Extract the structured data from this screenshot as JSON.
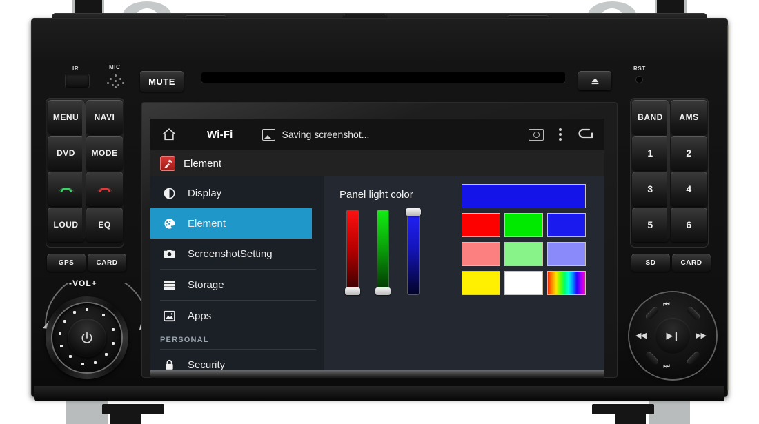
{
  "device": {
    "labels": {
      "ir": "IR",
      "mic": "MIC",
      "rst": "RST",
      "vol": "-VOL+"
    },
    "mute": "MUTE",
    "eject_icon": "eject-icon",
    "left_buttons": [
      "MENU",
      "NAVI",
      "DVD",
      "MODE",
      "call-answer-icon",
      "call-end-icon",
      "LOUD",
      "EQ"
    ],
    "left_bottom": [
      "GPS",
      "CARD"
    ],
    "right_buttons": [
      "BAND",
      "AMS",
      "1",
      "2",
      "3",
      "4",
      "5",
      "6"
    ],
    "right_bottom": [
      "SD",
      "CARD"
    ],
    "knob": {
      "power_icon": "power-icon"
    },
    "navpad": {
      "up": "⏮",
      "down": "⏭",
      "left": "◀◀",
      "right": "▶▶",
      "center": "▶❙"
    }
  },
  "screen": {
    "statusbar": {
      "home_icon": "home-icon",
      "wifi_label": "Wi-Fi",
      "screenshot_icon": "image-icon",
      "screenshot_text": "Saving screenshot...",
      "capture_icon": "screen-capture-icon",
      "overflow_icon": "kebab-menu-icon",
      "back_icon": "back-arrow-icon"
    },
    "app": {
      "icon": "element-app-icon",
      "title": "Element"
    },
    "sidebar": {
      "items": [
        {
          "label": "Display",
          "icon": "brightness-icon",
          "selected": false
        },
        {
          "label": "Element",
          "icon": "palette-icon",
          "selected": true
        },
        {
          "label": "ScreenshotSetting",
          "icon": "camera-icon",
          "selected": false
        },
        {
          "label": "Storage",
          "icon": "storage-icon",
          "selected": false
        },
        {
          "label": "Apps",
          "icon": "apps-image-icon",
          "selected": false
        }
      ],
      "section_header": "PERSONAL",
      "bottom_items": [
        {
          "label": "Security",
          "icon": "lock-icon",
          "selected": false
        }
      ]
    },
    "panel": {
      "title": "Panel light color",
      "sliders": [
        {
          "name": "red",
          "color": "#ff1111",
          "value": 0
        },
        {
          "name": "green",
          "color": "#13ee13",
          "value": 0
        },
        {
          "name": "blue",
          "color": "#2222ff",
          "value": 100
        }
      ],
      "preview_color": "#1414e8",
      "swatches": [
        {
          "name": "red",
          "color": "#fd0000"
        },
        {
          "name": "green",
          "color": "#00ea00"
        },
        {
          "name": "blue",
          "color": "#1a1aee"
        },
        {
          "name": "salmon",
          "color": "#fd8080"
        },
        {
          "name": "light-green",
          "color": "#88f388"
        },
        {
          "name": "periwinkle",
          "color": "#8a8afb"
        },
        {
          "name": "yellow",
          "color": "#ffef00"
        },
        {
          "name": "white",
          "color": "#ffffff"
        },
        {
          "name": "rainbow",
          "color": "rainbow"
        }
      ]
    }
  }
}
